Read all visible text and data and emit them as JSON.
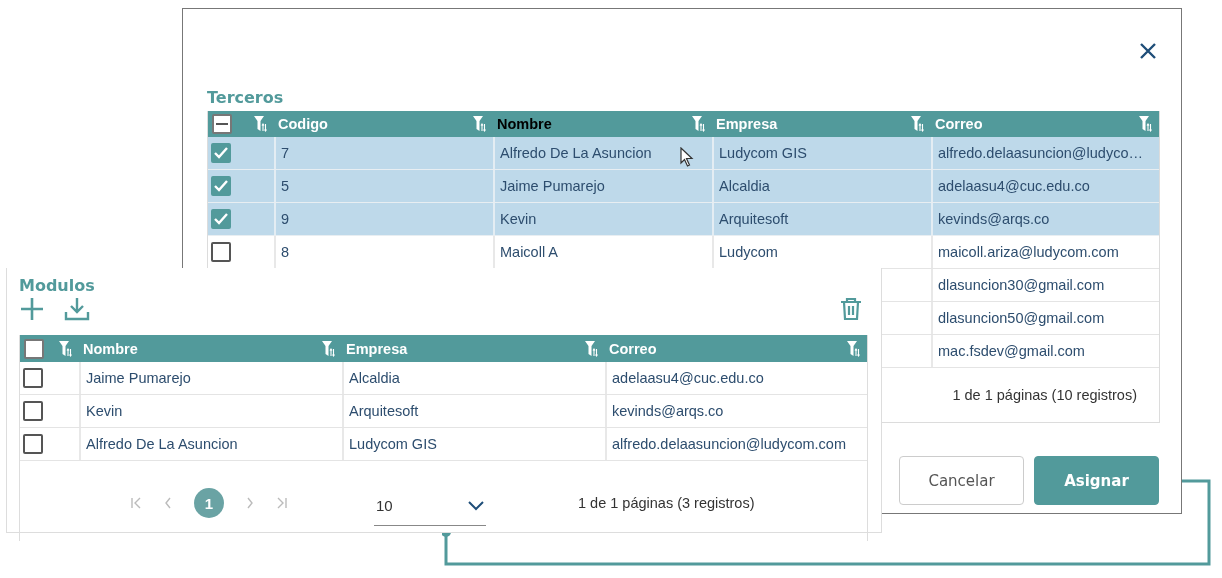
{
  "terceros_dialog": {
    "title": "Terceros",
    "header_checkbox": {
      "indeterminate": true
    },
    "columns": [
      {
        "label": "Codigo",
        "hovered": false
      },
      {
        "label": "Nombre",
        "hovered": true
      },
      {
        "label": "Empresa",
        "hovered": false
      },
      {
        "label": "Correo",
        "hovered": false
      }
    ],
    "rows": [
      {
        "codigo": "7",
        "nombre": "Alfredo De La Asuncion",
        "empresa": "Ludycom GIS",
        "correo": "alfredo.delaasuncion@ludyco…",
        "checked": true
      },
      {
        "codigo": "5",
        "nombre": "Jaime Pumarejo",
        "empresa": "Alcaldia",
        "correo": "adelaasu4@cuc.edu.co",
        "checked": true
      },
      {
        "codigo": "9",
        "nombre": "Kevin",
        "empresa": "Arquitesoft",
        "correo": "kevinds@arqs.co",
        "checked": true
      },
      {
        "codigo": "8",
        "nombre": "Maicoll A",
        "empresa": "Ludycom",
        "correo": "maicoll.ariza@ludycom.com",
        "checked": false
      },
      {
        "correo": "dlasuncion30@gmail.com"
      },
      {
        "correo": "dlasuncion50@gmail.com"
      },
      {
        "correo": "mac.fsdev@gmail.com"
      }
    ],
    "pagination_summary": "1 de 1 páginas (10 registros)",
    "buttons": [
      {
        "label": "Cancelar",
        "kind": "secondary"
      },
      {
        "label": "Asignar",
        "kind": "primary"
      }
    ]
  },
  "modulos_panel": {
    "title": "Modulos",
    "header_checkbox": {
      "indeterminate": false
    },
    "columns": [
      {
        "label": "Nombre"
      },
      {
        "label": "Empresa"
      },
      {
        "label": "Correo"
      }
    ],
    "rows": [
      {
        "nombre": "Jaime Pumarejo",
        "empresa": "Alcaldia",
        "correo": "adelaasu4@cuc.edu.co",
        "checked": false
      },
      {
        "nombre": "Kevin",
        "empresa": "Arquitesoft",
        "correo": "kevinds@arqs.co",
        "checked": false
      },
      {
        "nombre": "Alfredo De La Asuncion",
        "empresa": "Ludycom GIS",
        "correo": "alfredo.delaasuncion@ludycom.com",
        "checked": false
      }
    ],
    "pages": [
      {
        "label": "1",
        "selected": true
      }
    ],
    "page_size": "10",
    "pagination_summary": "1 de 1 páginas (3 registros)"
  }
}
